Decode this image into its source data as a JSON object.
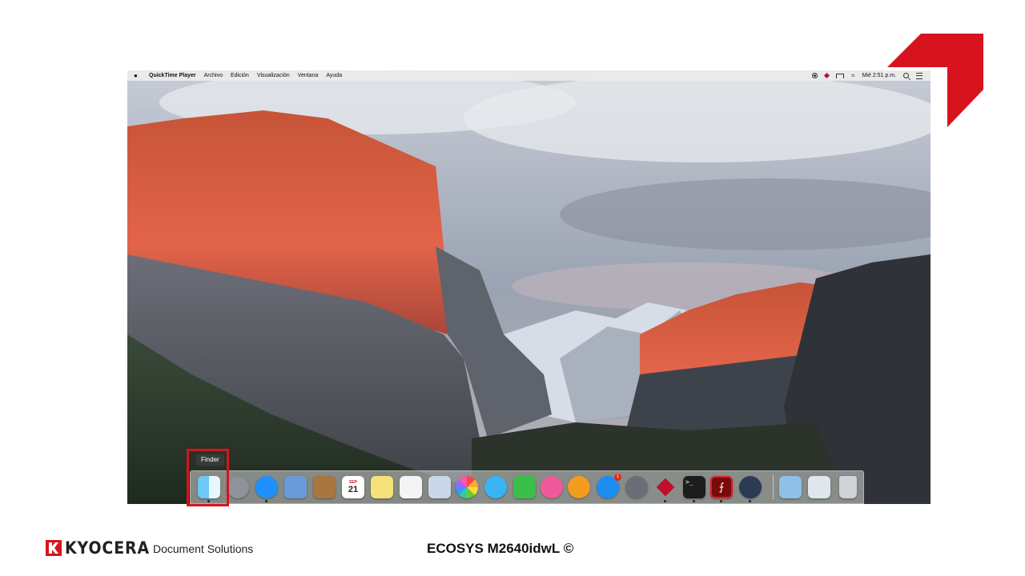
{
  "brand": {
    "corner_color": "#d7141e",
    "logo_text": "KYOCERA",
    "tagline": "Document Solutions",
    "model_label": "ECOSYS M2640idwL ©"
  },
  "menubar": {
    "apple_icon": "apple-icon",
    "app_name": "QuickTime Player",
    "items": [
      "Archivo",
      "Edición",
      "Visualización",
      "Ventana",
      "Ayuda"
    ],
    "clock": "Mié 2:51 p.m.",
    "status_icons": [
      "record-icon",
      "diamond-icon",
      "airplay-icon",
      "wifi-icon",
      "search-icon",
      "notification-list-icon"
    ]
  },
  "dock": {
    "tooltip": "Finder",
    "calendar_day": "21",
    "calendar_month": "SEP",
    "terminal_prompt": ">_",
    "appstore_badge": "1",
    "apps": [
      {
        "name": "finder",
        "color": "#2aa6f2"
      },
      {
        "name": "launchpad",
        "color": "#8d9399"
      },
      {
        "name": "safari",
        "color": "#1e90ff"
      },
      {
        "name": "mail",
        "color": "#6a9bd8"
      },
      {
        "name": "contacts",
        "color": "#a8773f"
      },
      {
        "name": "calendar",
        "color": "#ffffff"
      },
      {
        "name": "notes",
        "color": "#f6e27a"
      },
      {
        "name": "reminders",
        "color": "#f4f4f4"
      },
      {
        "name": "preview",
        "color": "#c9d7e8"
      },
      {
        "name": "photos",
        "color": "#ffffff"
      },
      {
        "name": "messages",
        "color": "#3ab3f5"
      },
      {
        "name": "facetime",
        "color": "#3bbf4b"
      },
      {
        "name": "itunes",
        "color": "#f05a9a"
      },
      {
        "name": "ibooks",
        "color": "#f39c1e"
      },
      {
        "name": "app-store",
        "color": "#1c8ef0"
      },
      {
        "name": "system-preferences",
        "color": "#6b6f75"
      },
      {
        "name": "kyocera-app",
        "color": "#c0102a"
      },
      {
        "name": "terminal",
        "color": "#1d1d1d"
      },
      {
        "name": "acrobat",
        "color": "#7a0a0a"
      },
      {
        "name": "quicktime",
        "color": "#2b3a55"
      },
      {
        "name": "utility",
        "color": "#8fc0e8"
      },
      {
        "name": "folder",
        "color": "#dfe6ee"
      },
      {
        "name": "trash",
        "color": "#cfd3d6"
      }
    ]
  }
}
